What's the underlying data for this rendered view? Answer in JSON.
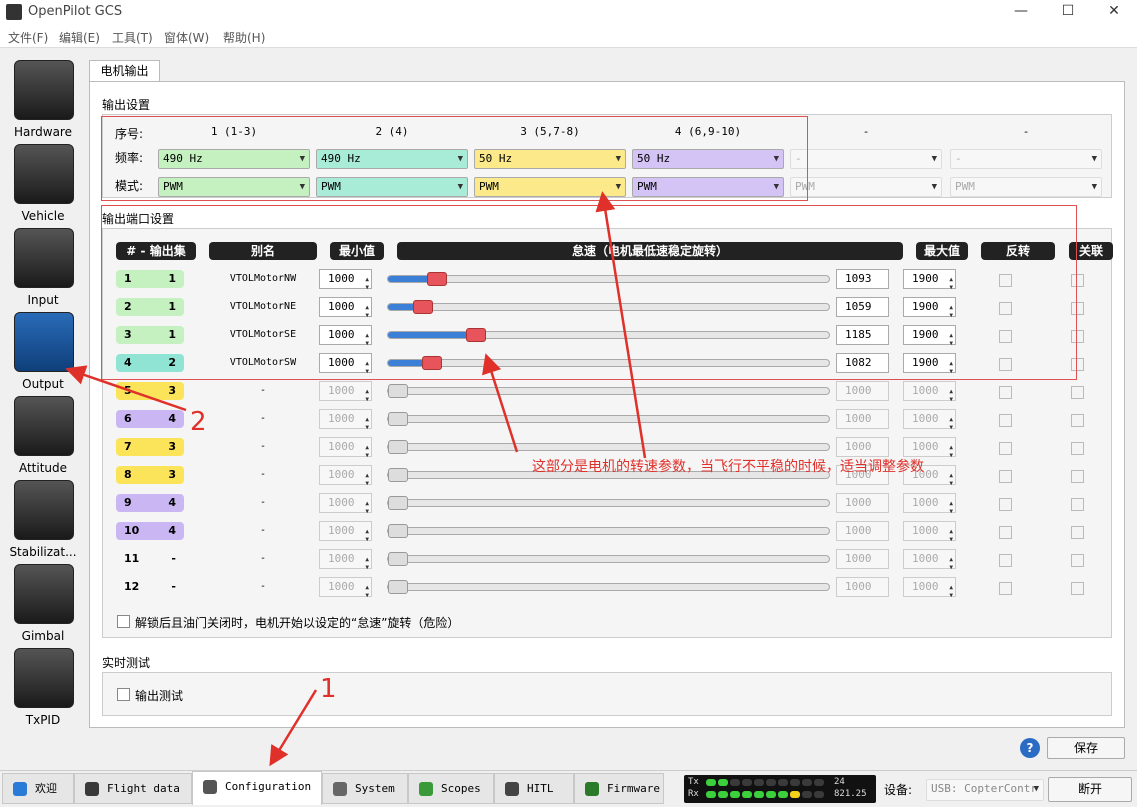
{
  "window": {
    "title": "OpenPilot GCS",
    "minimize": "—",
    "maximize": "☐",
    "close": "✕"
  },
  "menu": [
    "文件(F)",
    "编辑(E)",
    "工具(T)",
    "窗体(W)",
    "帮助(H)"
  ],
  "sidebar": [
    {
      "label": "Hardware",
      "icon": "chip-icon"
    },
    {
      "label": "Vehicle",
      "icon": "aircraft-icon"
    },
    {
      "label": "Input",
      "icon": "radio-transmitter-icon"
    },
    {
      "label": "Output",
      "icon": "motor-icon"
    },
    {
      "label": "Attitude",
      "icon": "attitude-indicator-icon"
    },
    {
      "label": "Stabilizat...",
      "icon": "gyro-icon"
    },
    {
      "label": "Gimbal",
      "icon": "camera-icon"
    },
    {
      "label": "TxPID",
      "icon": "meter-icon"
    }
  ],
  "tab_label": "电机输出",
  "output_settings": {
    "title": "输出设置",
    "row_labels": {
      "index": "序号:",
      "freq": "频率:",
      "mode": "模式:"
    },
    "banks": [
      {
        "index": "1 (1-3)",
        "freq": "490 Hz",
        "mode": "PWM",
        "color": "#c5f0c0",
        "enabled": true
      },
      {
        "index": "2 (4)",
        "freq": "490 Hz",
        "mode": "PWM",
        "color": "#a8ecd8",
        "enabled": true
      },
      {
        "index": "3 (5,7-8)",
        "freq": "50 Hz",
        "mode": "PWM",
        "color": "#fbe98a",
        "enabled": true
      },
      {
        "index": "4 (6,9-10)",
        "freq": "50 Hz",
        "mode": "PWM",
        "color": "#d4c4f5",
        "enabled": true
      },
      {
        "index": "-",
        "freq": "-",
        "mode": "PWM",
        "color": "#f7f7f7",
        "enabled": false
      },
      {
        "index": "-",
        "freq": "-",
        "mode": "PWM",
        "color": "#f7f7f7",
        "enabled": false
      }
    ]
  },
  "channel_settings": {
    "title": "输出端口设置",
    "headers": {
      "num_bank": "# - 输出集",
      "alias": "别名",
      "min": "最小值",
      "neutral": "怠速（电机最低速稳定旋转）",
      "max": "最大值",
      "reverse": "反转",
      "link": "关联"
    },
    "slider_min": 1000,
    "slider_max": 2000,
    "channels": [
      {
        "num": "1",
        "bank": "1",
        "color": "#c5f0c0",
        "alias": "VTOLMotorNW",
        "min": "1000",
        "neutral": 1093,
        "neutral_text": "1093",
        "max": "1900",
        "enabled": true
      },
      {
        "num": "2",
        "bank": "1",
        "color": "#c5f0c0",
        "alias": "VTOLMotorNE",
        "min": "1000",
        "neutral": 1059,
        "neutral_text": "1059",
        "max": "1900",
        "enabled": true
      },
      {
        "num": "3",
        "bank": "1",
        "color": "#c5f0c0",
        "alias": "VTOLMotorSE",
        "min": "1000",
        "neutral": 1185,
        "neutral_text": "1185",
        "max": "1900",
        "enabled": true
      },
      {
        "num": "4",
        "bank": "2",
        "color": "#8fe4d4",
        "alias": "VTOLMotorSW",
        "min": "1000",
        "neutral": 1082,
        "neutral_text": "1082",
        "max": "1900",
        "enabled": true
      },
      {
        "num": "5",
        "bank": "3",
        "color": "#fbe45a",
        "alias": "-",
        "min": "1000",
        "neutral": 1000,
        "neutral_text": "1000",
        "max": "1000",
        "enabled": false
      },
      {
        "num": "6",
        "bank": "4",
        "color": "#c9b6f3",
        "alias": "-",
        "min": "1000",
        "neutral": 1000,
        "neutral_text": "1000",
        "max": "1000",
        "enabled": false
      },
      {
        "num": "7",
        "bank": "3",
        "color": "#fbe45a",
        "alias": "-",
        "min": "1000",
        "neutral": 1000,
        "neutral_text": "1000",
        "max": "1000",
        "enabled": false
      },
      {
        "num": "8",
        "bank": "3",
        "color": "#fbe45a",
        "alias": "-",
        "min": "1000",
        "neutral": 1000,
        "neutral_text": "1000",
        "max": "1000",
        "enabled": false
      },
      {
        "num": "9",
        "bank": "4",
        "color": "#c9b6f3",
        "alias": "-",
        "min": "1000",
        "neutral": 1000,
        "neutral_text": "1000",
        "max": "1000",
        "enabled": false
      },
      {
        "num": "10",
        "bank": "4",
        "color": "#c9b6f3",
        "alias": "-",
        "min": "1000",
        "neutral": 1000,
        "neutral_text": "1000",
        "max": "1000",
        "enabled": false
      },
      {
        "num": "11",
        "bank": "-",
        "color": "",
        "alias": "-",
        "min": "1000",
        "neutral": 1000,
        "neutral_text": "1000",
        "max": "1000",
        "enabled": false
      },
      {
        "num": "12",
        "bank": "-",
        "color": "",
        "alias": "-",
        "min": "1000",
        "neutral": 1000,
        "neutral_text": "1000",
        "max": "1000",
        "enabled": false
      }
    ],
    "spin_on_arm_label": "解锁后且油门关闭时，电机开始以设定的“怠速”旋转（危险）"
  },
  "realtime": {
    "title": "实时测试",
    "checkbox_label": "输出测试"
  },
  "annotation": {
    "text": "这部分是电机的转速参数，当飞行不平稳的时候，适当调整参数",
    "marker1": "1",
    "marker2": "2"
  },
  "save_button": "保存",
  "help_icon": "?",
  "bottom_tabs": [
    {
      "label": "欢迎",
      "icon": "welcome-icon",
      "icon_color": "#2a7ad8"
    },
    {
      "label": "Flight data",
      "icon": "flight-data-icon",
      "icon_color": "#3a3a3a"
    },
    {
      "label": "Configuration",
      "icon": "wrench-icon",
      "icon_color": "#555"
    },
    {
      "label": "System",
      "icon": "gear-icon",
      "icon_color": "#666"
    },
    {
      "label": "Scopes",
      "icon": "scope-icon",
      "icon_color": "#3a9a3a"
    },
    {
      "label": "HITL",
      "icon": "gamepad-icon",
      "icon_color": "#444"
    },
    {
      "label": "Firmware",
      "icon": "chip-icon",
      "icon_color": "#2a7a2a"
    }
  ],
  "telemetry": {
    "tx_label": "Tx",
    "rx_label": "Rx",
    "tx_value": "24",
    "rx_value": "821.25"
  },
  "device_label": "设备:",
  "device_select": "USB: CopterContr",
  "disconnect_button": "断开"
}
